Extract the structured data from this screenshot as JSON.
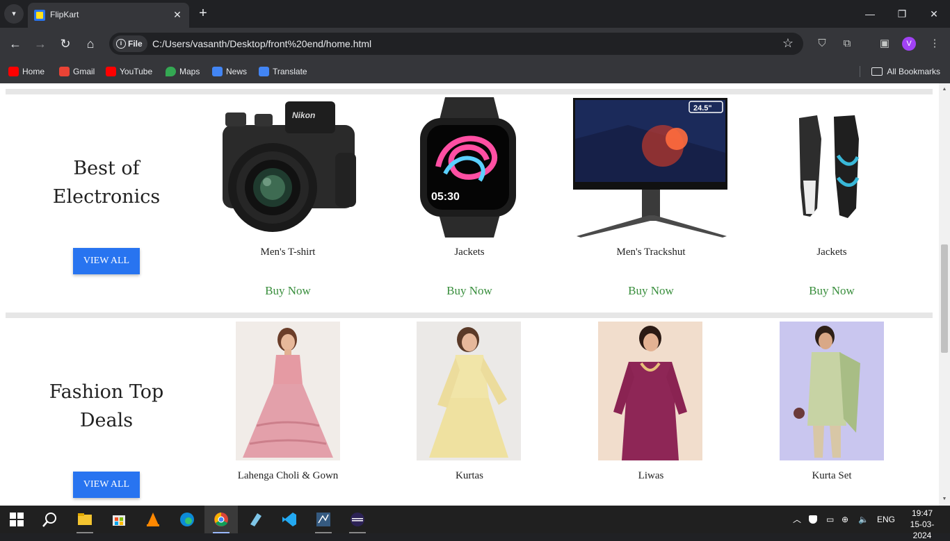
{
  "browser": {
    "tab_title": "FlipKart",
    "chip_label": "File",
    "url": "C:/Users/vasanth/Desktop/front%20end/home.html",
    "profile_initial": "V"
  },
  "bookmarks": {
    "items": [
      "Home",
      "Gmail",
      "YouTube",
      "Maps",
      "News",
      "Translate"
    ],
    "all_label": "All Bookmarks"
  },
  "page": {
    "sections": [
      {
        "title_line1": "Best of",
        "title_line2": "Electronics",
        "view_all": "VIEW ALL",
        "products": [
          {
            "name": "Men's T-shirt",
            "action": "Buy Now"
          },
          {
            "name": "Jackets",
            "action": "Buy Now"
          },
          {
            "name": "Men's Trackshut",
            "action": "Buy Now"
          },
          {
            "name": "Jackets",
            "action": "Buy Now"
          }
        ]
      },
      {
        "title_line1": "Fashion Top",
        "title_line2": "Deals",
        "view_all": "VIEW ALL",
        "products": [
          {
            "name": "Lahenga Choli & Gown"
          },
          {
            "name": "Kurtas"
          },
          {
            "name": "Liwas"
          },
          {
            "name": "Kurta Set"
          }
        ]
      }
    ]
  },
  "monitor_badge": "24.5\"",
  "watch_time": "05:30",
  "taskbar": {
    "lang": "ENG",
    "time": "19:47",
    "date": "15-03-2024"
  },
  "colors": {
    "accent_blue": "#2874f0",
    "buy_green": "#388e3c"
  }
}
